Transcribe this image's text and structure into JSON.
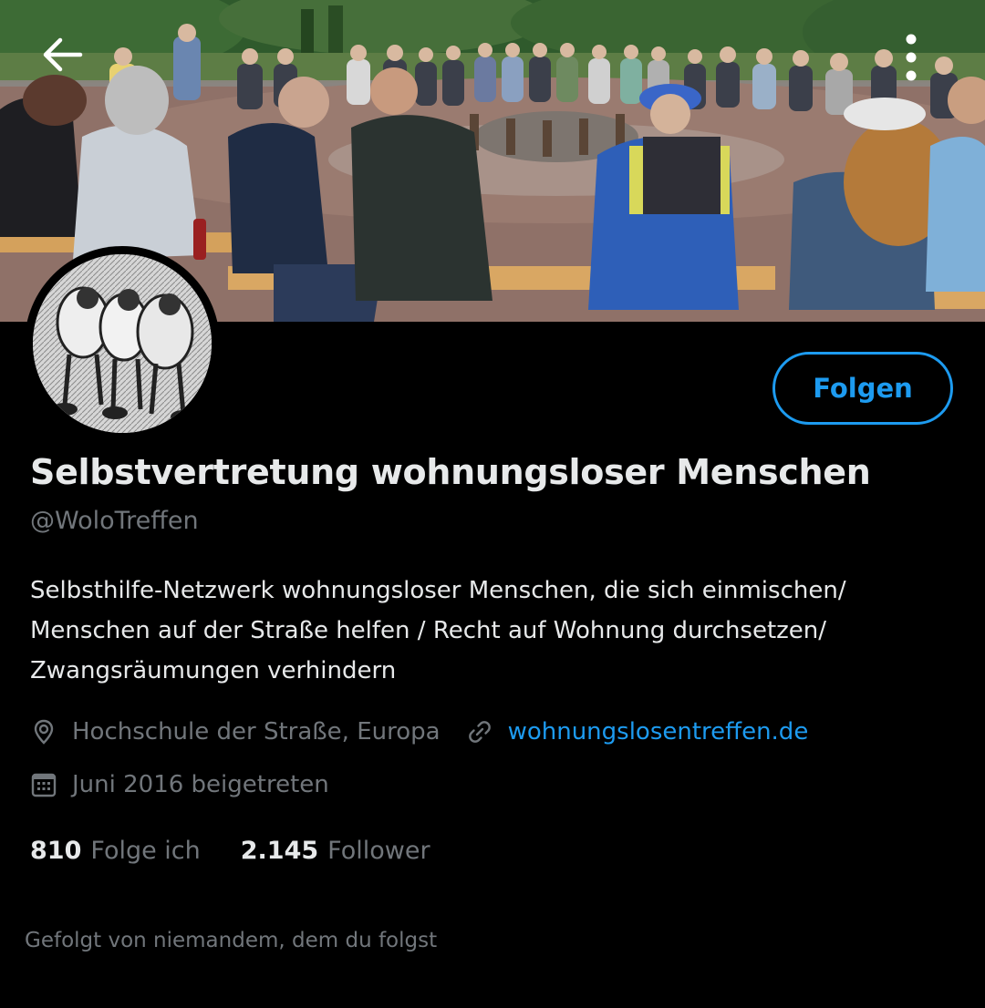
{
  "header": {
    "back_icon": "arrow-left-icon",
    "more_icon": "more-vertical-icon"
  },
  "profile": {
    "display_name": "Selbstvertretung wohnungsloser Menschen",
    "handle": "@WoloTreffen",
    "follow_label": "Folgen",
    "bio_lines": [
      "Selbsthilfe-Netzwerk wohnungsloser Menschen, die sich einmischen/",
      "Menschen auf der Straße helfen / Recht auf Wohnung durchsetzen/",
      "Zwangsräumungen verhindern"
    ],
    "location": "Hochschule der Straße, Europa",
    "website": "wohnungslosentreffen.de",
    "joined": "Juni 2016 beigetreten",
    "following_count": "810",
    "following_label": "Folge ich",
    "followers_count": "2.145",
    "followers_label": "Follower",
    "followed_by_text": "Gefolgt von niemandem, dem du folgst"
  },
  "colors": {
    "background": "#000000",
    "primary_text": "#e7e9ea",
    "secondary_text": "#71767b",
    "accent": "#1d9bf0"
  }
}
